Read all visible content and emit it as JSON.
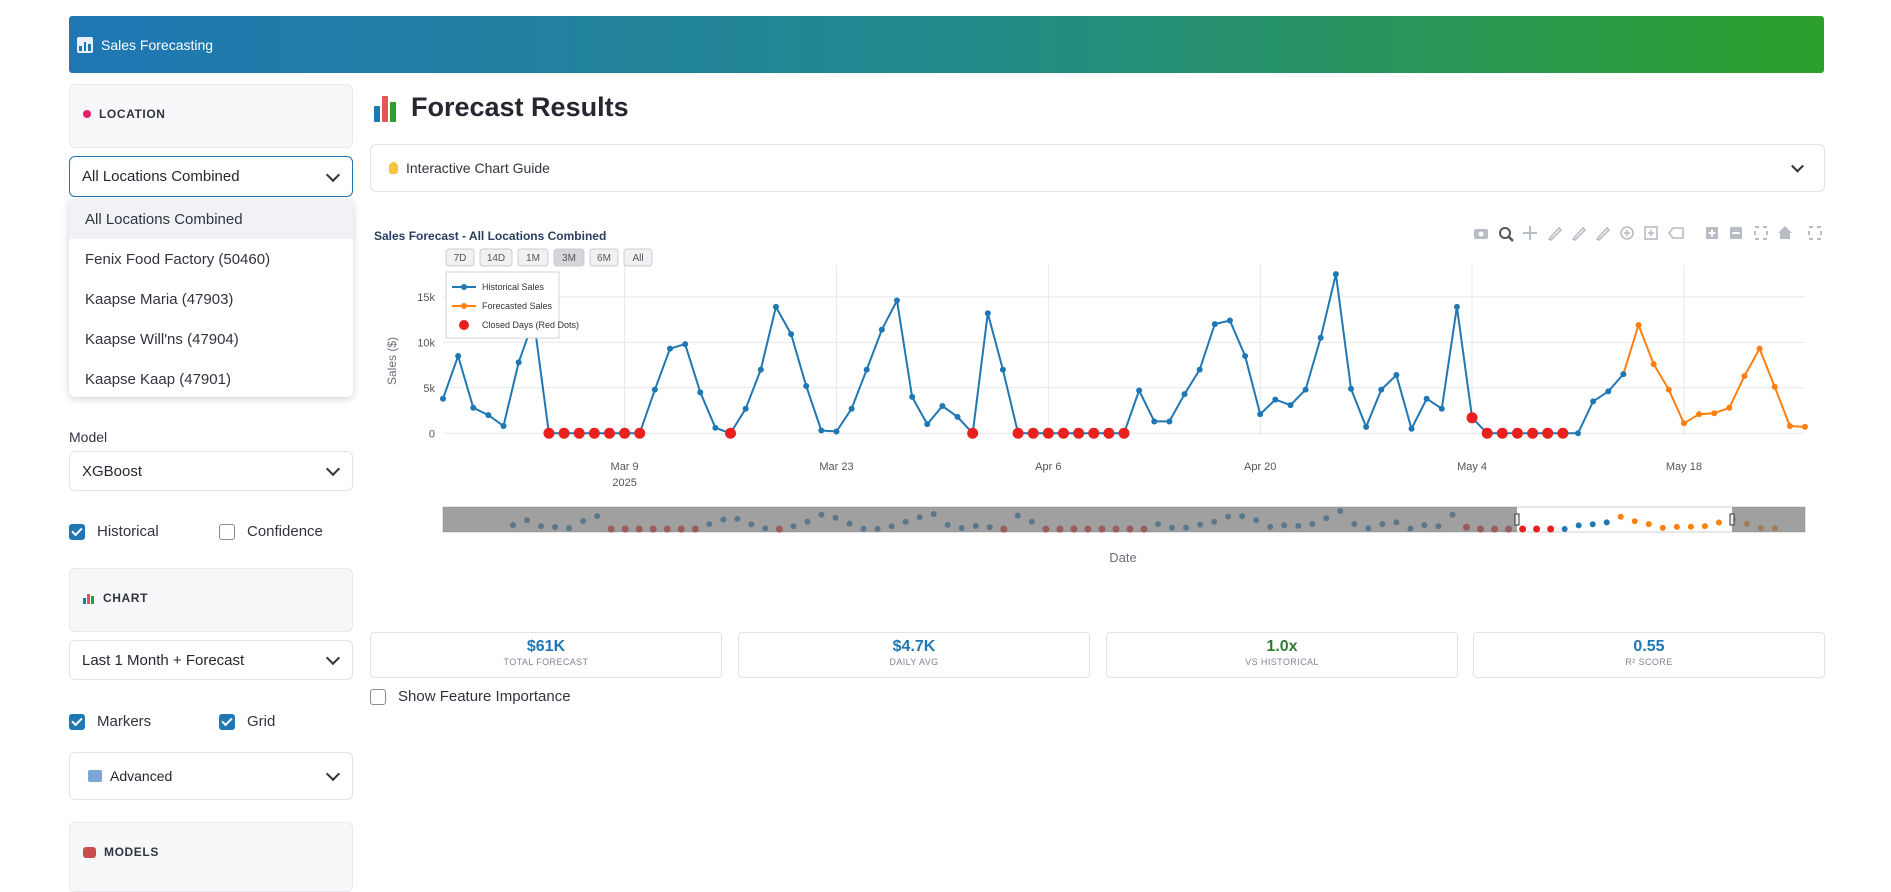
{
  "banner": {
    "title": "Sales Forecasting"
  },
  "sidebar": {
    "location": {
      "title": "LOCATION",
      "selected": "All Locations Combined",
      "options": [
        "All Locations Combined",
        "Fenix Food Factory (50460)",
        "Kaapse Maria (47903)",
        "Kaapse Will'ns (47904)",
        "Kaapse Kaap (47901)"
      ]
    },
    "model": {
      "label": "Model",
      "selected": "XGBoost"
    },
    "historical": {
      "label": "Historical",
      "checked": true
    },
    "confidence": {
      "label": "Confidence",
      "checked": false
    },
    "chart": {
      "title": "CHART",
      "range": "Last 1 Month + Forecast"
    },
    "markers": {
      "label": "Markers",
      "checked": true
    },
    "grid": {
      "label": "Grid",
      "checked": true
    },
    "advanced": {
      "label": "Advanced"
    },
    "models": {
      "title": "MODELS"
    }
  },
  "main": {
    "title": "Forecast Results",
    "guide": "Interactive Chart Guide",
    "show_feature_importance": "Show Feature Importance"
  },
  "metrics": [
    {
      "value": "$61K",
      "label": "TOTAL FORECAST",
      "color": "#1f77b4"
    },
    {
      "value": "$4.7K",
      "label": "DAILY AVG",
      "color": "#1f77b4"
    },
    {
      "value": "1.0x",
      "label": "VS HISTORICAL",
      "color": "#2e7d32"
    },
    {
      "value": "0.55",
      "label": "R² SCORE",
      "color": "#1f77b4"
    }
  ],
  "colors": {
    "historical": "#1f77b4",
    "forecast": "#ff7f0e",
    "closed": "#e8211e"
  },
  "range_buttons": [
    "7D",
    "14D",
    "1M",
    "3M",
    "6M",
    "All"
  ],
  "active_range": "3M",
  "chart_data": {
    "type": "line",
    "title": "Sales Forecast - All Locations Combined",
    "xlabel": "Date",
    "ylabel": "Sales ($)",
    "ylim": [
      -300,
      18500
    ],
    "x_start": "2025-02-25",
    "x_ticks": [
      {
        "label": "Mar 9",
        "sub": "2025",
        "date": "2025-03-09"
      },
      {
        "label": "Mar 23",
        "date": "2025-03-23"
      },
      {
        "label": "Apr 6",
        "date": "2025-04-06"
      },
      {
        "label": "Apr 20",
        "date": "2025-04-20"
      },
      {
        "label": "May 4",
        "date": "2025-05-04"
      },
      {
        "label": "May 18",
        "date": "2025-05-18"
      }
    ],
    "y_ticks": [
      0,
      5000,
      10000,
      15000
    ],
    "y_tick_labels": [
      "0",
      "5k",
      "10k",
      "15k"
    ],
    "legend": [
      "Historical Sales",
      "Forecasted Sales",
      "Closed Days (Red Dots)"
    ],
    "historical": [
      3800,
      8500,
      2800,
      2000,
      800,
      7800,
      12500,
      0,
      0,
      0,
      0,
      0,
      0,
      0,
      4800,
      9300,
      9800,
      4500,
      600,
      0,
      2700,
      7000,
      13900,
      10900,
      5200,
      300,
      200,
      2700,
      7000,
      11400,
      14600,
      4000,
      1000,
      3000,
      1800,
      0,
      13200,
      7000,
      0,
      0,
      0,
      0,
      0,
      0,
      0,
      0,
      4700,
      1300,
      1300,
      4300,
      7000,
      12000,
      12400,
      8500,
      2100,
      3700,
      3100,
      4800,
      10500,
      17500,
      4900,
      700,
      4800,
      6400,
      500,
      3800,
      2700,
      13900,
      1700,
      0,
      0,
      0,
      0,
      0,
      0,
      0,
      3500,
      4600,
      6500
    ],
    "forecast": [
      6500,
      11900,
      7600,
      4800,
      1100,
      2100,
      2200,
      2800,
      6300,
      9300,
      5100,
      800,
      700
    ],
    "closed_index": [
      7,
      8,
      9,
      10,
      11,
      12,
      13,
      19,
      35,
      38,
      39,
      40,
      41,
      42,
      43,
      44,
      45,
      68,
      69,
      70,
      71,
      72,
      73,
      74
    ]
  }
}
